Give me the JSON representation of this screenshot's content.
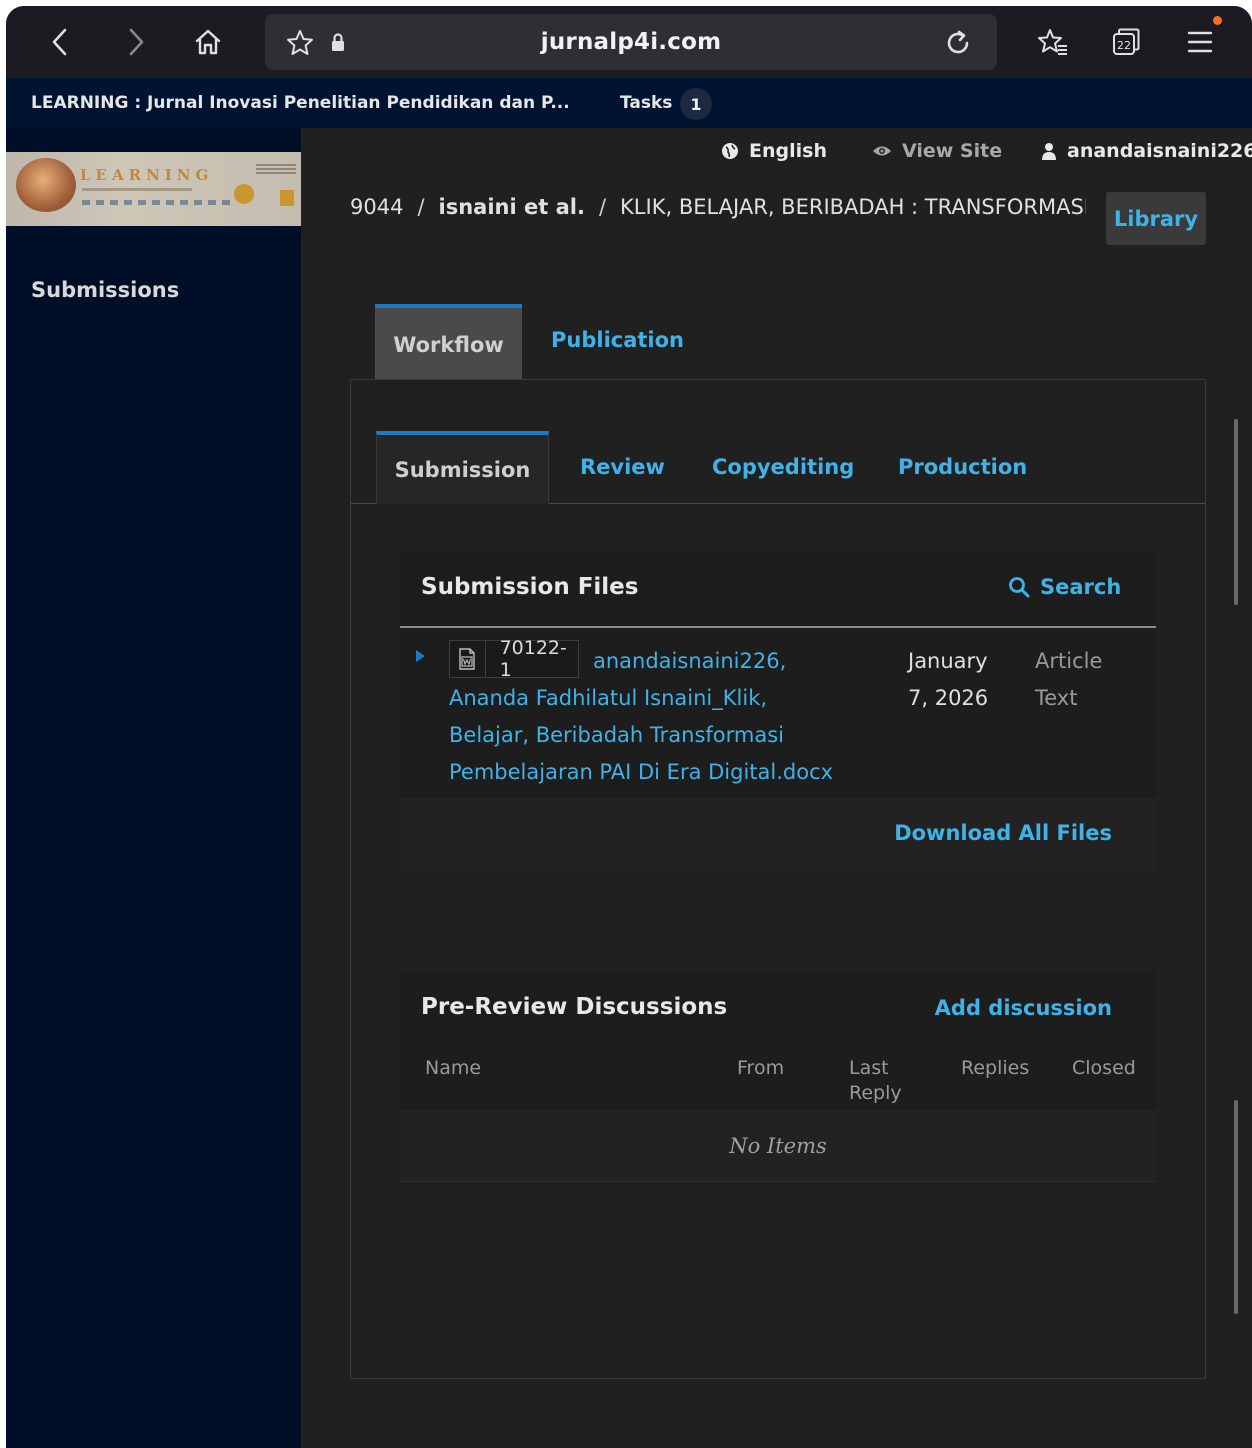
{
  "browser": {
    "url": "jurnalp4i.com",
    "tab_count": "22"
  },
  "topbar": {
    "journal_title": "LEARNING : Jurnal Inovasi Penelitian Pendidikan dan P...",
    "tasks_label": "Tasks",
    "tasks_count": "1"
  },
  "header": {
    "language": "English",
    "view_site": "View Site",
    "username": "anandaisnaini226"
  },
  "logo": {
    "text": "LEARNING"
  },
  "sidebar": {
    "items": [
      {
        "label": "Submissions"
      }
    ]
  },
  "breadcrumb": {
    "id": "9044",
    "authors": "isnaini et al.",
    "title": "KLIK, BELAJAR, BERIBADAH : TRANSFORMASI PEMBELAJARAN PAI DI ERA DIGITAL",
    "library_button": "Library"
  },
  "tabs": {
    "workflow": "Workflow",
    "publication": "Publication"
  },
  "subtabs": {
    "submission": "Submission",
    "review": "Review",
    "copyediting": "Copyediting",
    "production": "Production"
  },
  "submission_files": {
    "title": "Submission Files",
    "search_label": "Search",
    "files": [
      {
        "id": "70122-1",
        "name": "anandaisnaini226, Ananda Fadhilatul Isnaini_Klik, Belajar, Beribadah Transformasi Pembelajaran PAI Di Era Digital.docx",
        "date": "January 7, 2026",
        "type": "Article Text"
      }
    ],
    "download_all": "Download All Files"
  },
  "discussions": {
    "title": "Pre-Review Discussions",
    "add_label": "Add discussion",
    "columns": [
      "Name",
      "From",
      "Last Reply",
      "Replies",
      "Closed"
    ],
    "empty_text": "No Items"
  },
  "colors": {
    "link": "#3fb3e8",
    "accent_border": "#1b7bc7",
    "sidebar_bg": "#000f27",
    "notification_dot": "#ff6a2a"
  }
}
